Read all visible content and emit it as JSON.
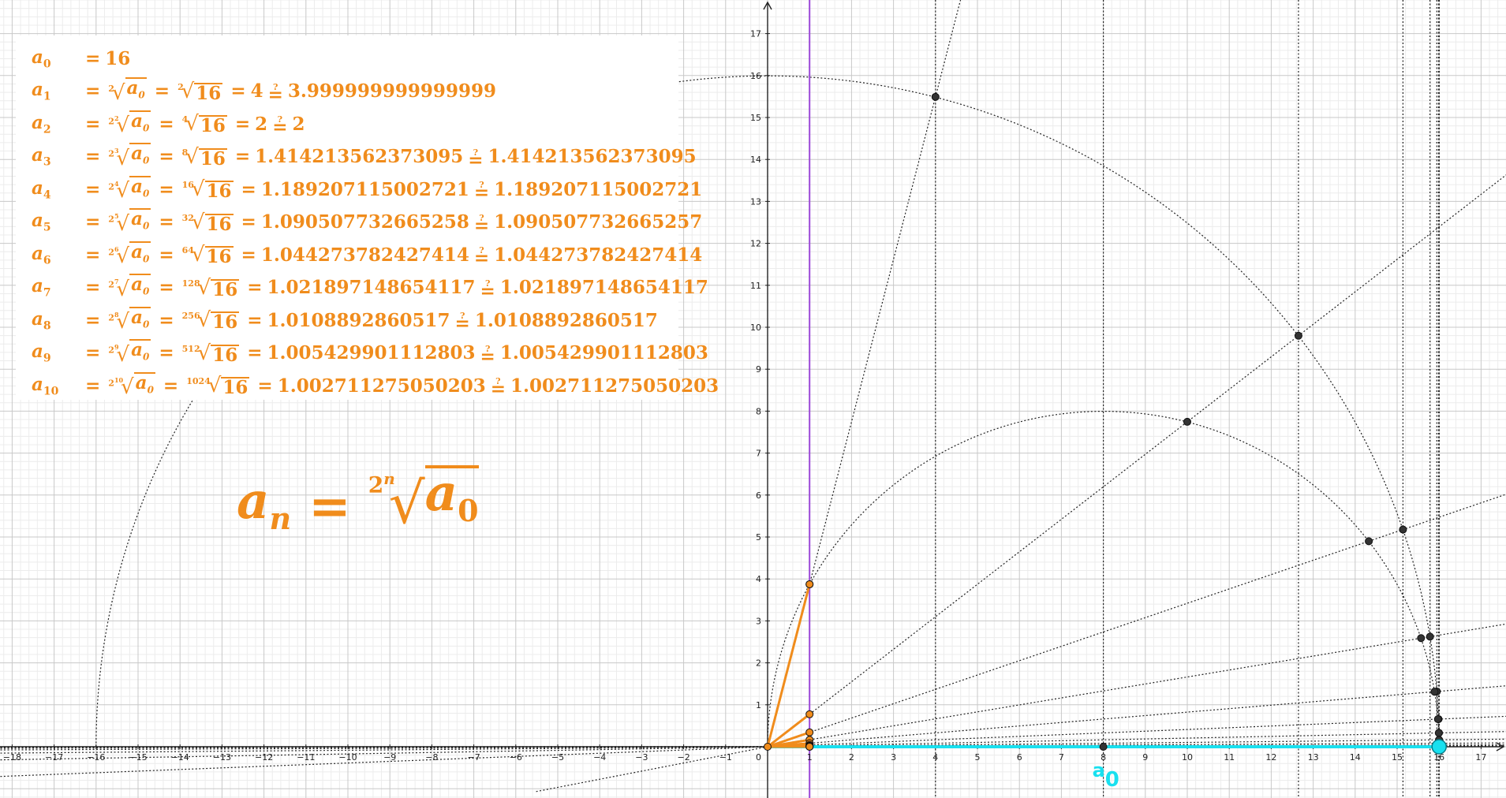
{
  "formulas": [
    {
      "name": "a",
      "sub": "0",
      "index_base": "",
      "index_exp": "",
      "radicand_sym": "",
      "root_index": "",
      "value": "16",
      "approx": ""
    },
    {
      "name": "a",
      "sub": "1",
      "index_base": "2",
      "index_exp": "",
      "root_index": "2",
      "value": "4",
      "approx": "3.999999999999999"
    },
    {
      "name": "a",
      "sub": "2",
      "index_base": "2",
      "index_exp": "2",
      "root_index": "4",
      "value": "2",
      "approx": "2"
    },
    {
      "name": "a",
      "sub": "3",
      "index_base": "2",
      "index_exp": "3",
      "root_index": "8",
      "value": "1.414213562373095",
      "approx": "1.414213562373095"
    },
    {
      "name": "a",
      "sub": "4",
      "index_base": "2",
      "index_exp": "4",
      "root_index": "16",
      "value": "1.189207115002721",
      "approx": "1.189207115002721"
    },
    {
      "name": "a",
      "sub": "5",
      "index_base": "2",
      "index_exp": "5",
      "root_index": "32",
      "value": "1.090507732665258",
      "approx": "1.090507732665257"
    },
    {
      "name": "a",
      "sub": "6",
      "index_base": "2",
      "index_exp": "6",
      "root_index": "64",
      "value": "1.044273782427414",
      "approx": "1.044273782427414"
    },
    {
      "name": "a",
      "sub": "7",
      "index_base": "2",
      "index_exp": "7",
      "root_index": "128",
      "value": "1.021897148654117",
      "approx": "1.021897148654117"
    },
    {
      "name": "a",
      "sub": "8",
      "index_base": "2",
      "index_exp": "8",
      "root_index": "256",
      "value": "1.0108892860517",
      "approx": "1.0108892860517"
    },
    {
      "name": "a",
      "sub": "9",
      "index_base": "2",
      "index_exp": "9",
      "root_index": "512",
      "value": "1.005429901112803",
      "approx": "1.005429901112803"
    },
    {
      "name": "a",
      "sub": "10",
      "index_base": "2",
      "index_exp": "10",
      "root_index": "1024",
      "value": "1.002711275050203",
      "approx": "1.002711275050203"
    }
  ],
  "formula_symbols": {
    "radical": "√",
    "radicand_var": "a",
    "radicand_sub": "0",
    "sixteen": "16",
    "equals": "=",
    "qmark": "?"
  },
  "general_formula": {
    "lhs": "a",
    "lhs_sub": "n",
    "equals": "=",
    "index_base": "2",
    "index_exp": "n",
    "radical": "√",
    "radicand": "a",
    "radicand_sub": "0"
  },
  "a0_label": {
    "base": "a",
    "sub": "0"
  },
  "axes": {
    "x_range": [
      -18.5,
      17.7
    ],
    "y_range": [
      -1.2,
      17.8
    ],
    "x_ticks": [
      -18,
      -17,
      -16,
      -15,
      -14,
      -13,
      -12,
      -11,
      -10,
      -9,
      -8,
      -7,
      -6,
      -5,
      -4,
      -3,
      -2,
      -1,
      1,
      2,
      3,
      4,
      5,
      6,
      7,
      8,
      9,
      10,
      11,
      12,
      13,
      14,
      15,
      16,
      17
    ],
    "y_ticks": [
      1,
      2,
      3,
      4,
      5,
      6,
      7,
      8,
      9,
      10,
      11,
      12,
      13,
      14,
      15,
      16,
      17
    ],
    "origin_label": "0"
  },
  "colors": {
    "orange": "#f08c1c",
    "cyan": "#19e0ef",
    "purple": "#9b48d8",
    "point": "#333333",
    "axis": "#222222",
    "grid_major": "#c8c8c8",
    "grid_minor": "#ececec",
    "construction": "#222222"
  },
  "a0_value": 16
}
